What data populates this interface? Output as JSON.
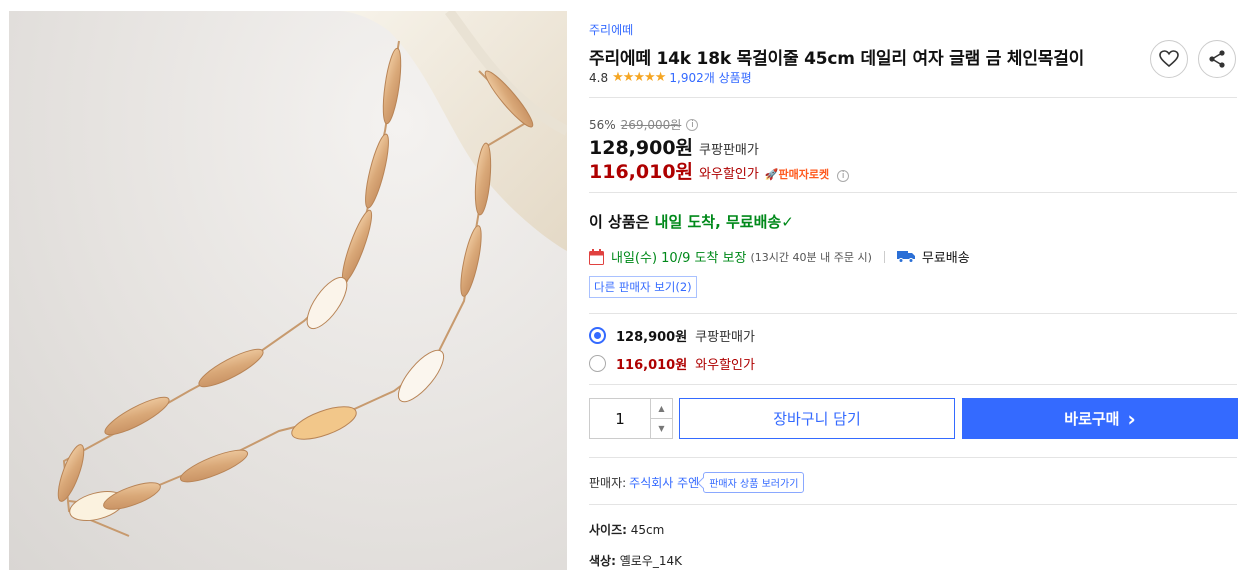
{
  "product": {
    "image_alt": "gold flat chain necklace",
    "brand": "주리에떼",
    "title": "주리에떼 14k 18k 목걸이줄 45cm 데일리 여자 글램 금 체인목걸이",
    "rating": "4.8",
    "stars": "★★★★★",
    "review_count": "1,902개 상품평"
  },
  "pricing": {
    "discount_rate": "56%",
    "original_price": "269,000원",
    "coupang_price": "128,900원",
    "coupang_price_label": "쿠팡판매가",
    "wow_price": "116,010원",
    "wow_price_label": "와우할인가",
    "seller_rocket": "🚀판매자로켓"
  },
  "delivery": {
    "headline_prefix": "이 상품은 ",
    "headline_highlight": "내일 도착, 무료배송",
    "headline_check": "✓",
    "arrival": "내일(수) 10/9 도착 보장",
    "order_deadline": "(13시간 40분 내 주문 시)",
    "shipping": "무료배송",
    "other_sellers": "다른 판매자 보기(2)"
  },
  "options": [
    {
      "price": "128,900원",
      "label": "쿠팡판매가",
      "selected": true
    },
    {
      "price": "116,010원",
      "label": "와우할인가",
      "selected": false
    }
  ],
  "purchase": {
    "quantity": "1",
    "cart_label": "장바구니 담기",
    "buy_label": "바로구매",
    "buy_chevron": "›"
  },
  "seller": {
    "label": "판매자:",
    "name": "주식회사 주엔",
    "store_link": "판매자 상품 보러가기"
  },
  "attributes": {
    "size_label": "사이즈:",
    "size_value": "45cm",
    "color_label": "색상:",
    "color_value": "옐로우_14K"
  },
  "colors": {
    "accent": "#346aff",
    "wow_red": "#ae0000",
    "delivery_green": "#00891a",
    "star": "#f5a623"
  }
}
